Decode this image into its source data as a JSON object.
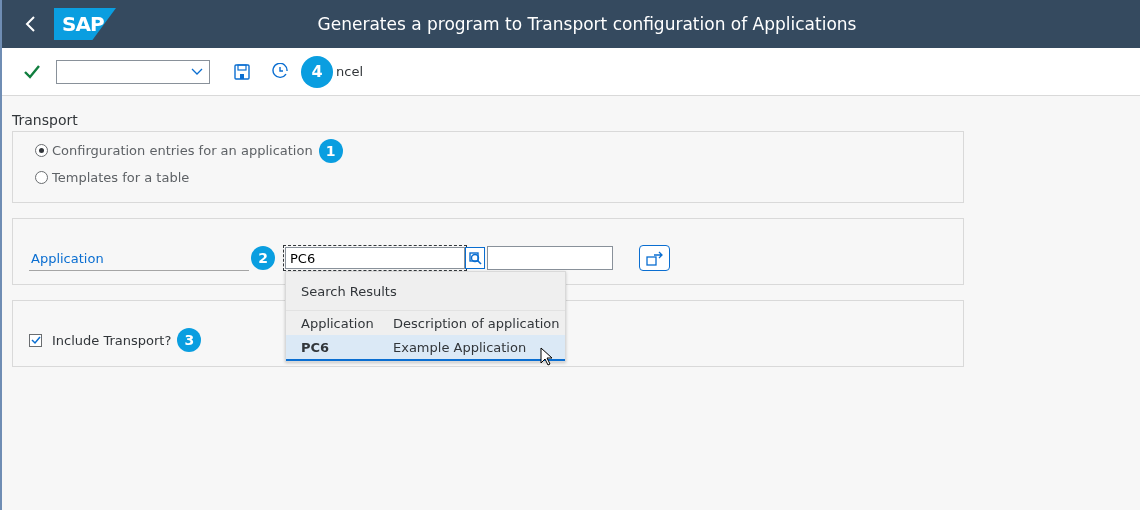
{
  "header": {
    "logo": "SAP",
    "title": "Generates a program to Transport configuration of Applications"
  },
  "toolbar": {
    "cancel_label": "ncel",
    "callout": "4"
  },
  "transport": {
    "title": "Transport",
    "options": [
      {
        "label": "Confirguration entries for an application",
        "selected": true,
        "callout": "1"
      },
      {
        "label": "Templates for a table",
        "selected": false
      }
    ]
  },
  "application": {
    "label": "Application",
    "callout": "2",
    "value": "PC6",
    "search_results": {
      "title": "Search Results",
      "columns": [
        "Application",
        "Description of application"
      ],
      "rows": [
        {
          "cells": [
            "PC6",
            "Example Application"
          ],
          "selected": true
        }
      ]
    }
  },
  "include_transport": {
    "label": "Include Transport?",
    "checked": true,
    "callout": "3"
  }
}
